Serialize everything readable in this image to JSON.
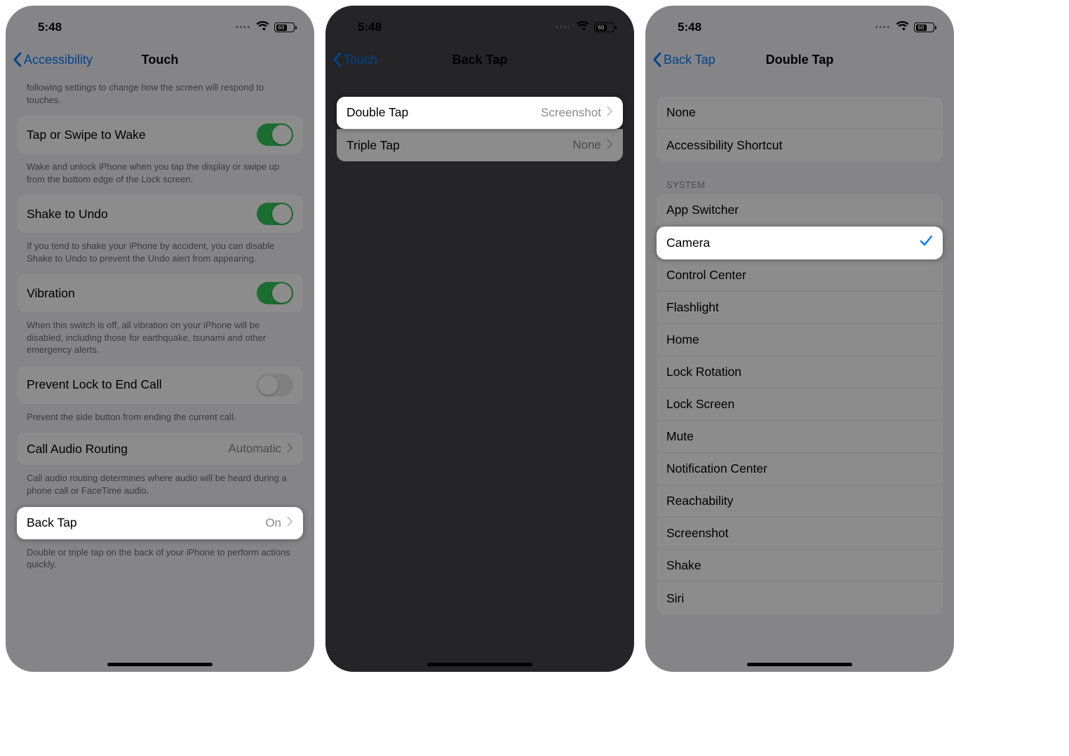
{
  "status": {
    "time": "5:48",
    "battery_pct": "60"
  },
  "screen1": {
    "back": "Accessibility",
    "title": "Touch",
    "intro_footer": "following settings to change how the screen will respond to touches.",
    "tap_wake": {
      "label": "Tap or Swipe to Wake",
      "footer": "Wake and unlock iPhone when you tap the display or swipe up from the bottom edge of the Lock screen."
    },
    "shake_undo": {
      "label": "Shake to Undo",
      "footer": "If you tend to shake your iPhone by accident, you can disable Shake to Undo to prevent the Undo alert from appearing."
    },
    "vibration": {
      "label": "Vibration",
      "footer": "When this switch is off, all vibration on your iPhone will be disabled, including those for earthquake, tsunami and other emergency alerts."
    },
    "prevent_lock": {
      "label": "Prevent Lock to End Call",
      "footer": "Prevent the side button from ending the current call."
    },
    "call_audio": {
      "label": "Call Audio Routing",
      "value": "Automatic",
      "footer": "Call audio routing determines where audio will be heard during a phone call or FaceTime audio."
    },
    "back_tap": {
      "label": "Back Tap",
      "value": "On",
      "footer": "Double or triple tap on the back of your iPhone to perform actions quickly."
    }
  },
  "screen2": {
    "back": "Touch",
    "title": "Back Tap",
    "double_tap": {
      "label": "Double Tap",
      "value": "Screenshot"
    },
    "triple_tap": {
      "label": "Triple Tap",
      "value": "None"
    }
  },
  "screen3": {
    "back": "Back Tap",
    "title": "Double Tap",
    "top_group": [
      "None",
      "Accessibility Shortcut"
    ],
    "system_header": "System",
    "system_items": [
      "App Switcher",
      "Camera",
      "Control Center",
      "Flashlight",
      "Home",
      "Lock Rotation",
      "Lock Screen",
      "Mute",
      "Notification Center",
      "Reachability",
      "Screenshot",
      "Shake",
      "Siri"
    ],
    "selected": "Camera"
  }
}
